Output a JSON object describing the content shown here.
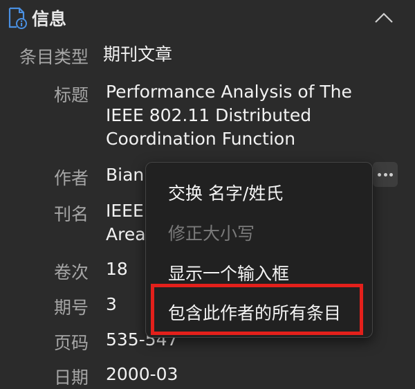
{
  "header": {
    "title": "信息"
  },
  "fields": {
    "item_type": {
      "label": "条目类型",
      "value": "期刊文章"
    },
    "title": {
      "label": "标题",
      "lines": [
        "Performance Analysis of The",
        "IEEE 802.11 Distributed",
        "Coordination Function"
      ]
    },
    "author": {
      "label": "作者",
      "value": "Bian"
    },
    "journal": {
      "label": "刊名",
      "lines": [
        "IEEE",
        "Area"
      ]
    },
    "volume": {
      "label": "卷次",
      "value": "18"
    },
    "issue": {
      "label": "期号",
      "value": "3"
    },
    "pages": {
      "label": "页码",
      "value": "535-547"
    },
    "date": {
      "label": "日期",
      "value": "2000-03"
    }
  },
  "context_menu": {
    "items": [
      {
        "label": "交换 名字/姓氏",
        "enabled": true
      },
      {
        "label": "修正大小写",
        "enabled": false
      },
      {
        "label": "显示一个输入框",
        "enabled": true
      },
      {
        "label": "包含此作者的所有条目",
        "enabled": true,
        "highlighted": true
      }
    ]
  },
  "icons": {
    "section": "document-info-icon",
    "collapse": "chevron-up-icon",
    "more": "more-options-icon"
  },
  "colors": {
    "background": "#2b2b2b",
    "menu_background": "#212121",
    "highlight": "#e3201b",
    "icon_blue": "#4a90e2"
  }
}
